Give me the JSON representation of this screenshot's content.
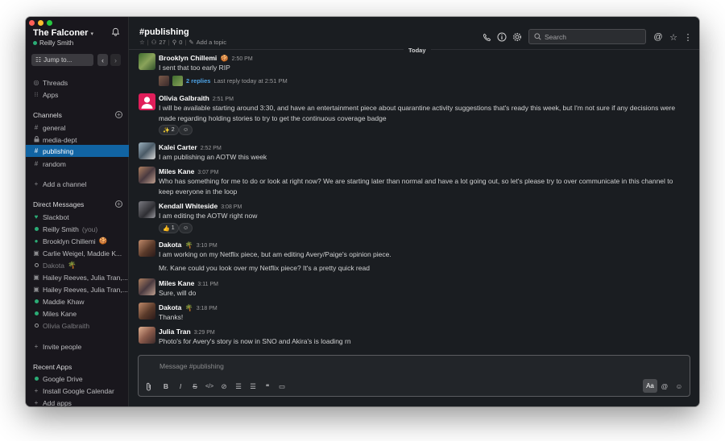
{
  "workspace": {
    "name": "The Falconer",
    "user": "Reilly Smith",
    "jump_label": "Jump to..."
  },
  "sidebar": {
    "threads": "Threads",
    "apps": "Apps",
    "channels_header": "Channels",
    "channels": [
      {
        "name": "general",
        "prefix": "#"
      },
      {
        "name": "media-dept",
        "prefix": "🔒"
      },
      {
        "name": "publishing",
        "prefix": "#",
        "active": true
      },
      {
        "name": "random",
        "prefix": "#"
      }
    ],
    "add_channel": "Add a channel",
    "dm_header": "Direct Messages",
    "dms": [
      {
        "label": "Slackbot",
        "icon": "heart"
      },
      {
        "label": "Reilly Smith",
        "suffix": "(you)",
        "icon": "online"
      },
      {
        "label": "Brooklyn Chillemi",
        "emoji": "🍪",
        "icon": "online-flag"
      },
      {
        "label": "Carlie Weigel, Maddie K...",
        "icon": "group"
      },
      {
        "label": "Dakota",
        "emoji": "🌴",
        "icon": "away"
      },
      {
        "label": "Hailey Reeves, Julia Tran,...",
        "icon": "group"
      },
      {
        "label": "Hailey Reeves, Julia Tran,...",
        "icon": "group"
      },
      {
        "label": "Maddie Khaw",
        "icon": "online"
      },
      {
        "label": "Miles Kane",
        "icon": "online"
      },
      {
        "label": "Olivia Galbraith",
        "icon": "away"
      }
    ],
    "invite": "Invite people",
    "apps_header": "Recent Apps",
    "recent_apps": [
      {
        "label": "Google Drive",
        "icon": "online"
      },
      {
        "label": "Install Google Calendar",
        "icon": "plus"
      },
      {
        "label": "Add apps",
        "icon": "plus"
      }
    ]
  },
  "channel": {
    "name": "#publishing",
    "members": "27",
    "pins": "0",
    "topic": "Add a topic",
    "search_placeholder": "Search",
    "divider": "Today"
  },
  "messages": [
    {
      "author": "Brooklyn Chillemi",
      "emoji": "🍪",
      "time": "2:50 PM",
      "text": "I sent that too early RIP",
      "avatar_color": "#4a7a3a",
      "thread": {
        "replies": "2 replies",
        "last": "Last reply today at 2:51 PM"
      }
    },
    {
      "author": "Olivia Galbraith",
      "time": "2:51 PM",
      "text": "I will be available starting around 3:30, and have an entertainment piece about quarantine activity suggestions that's ready this week, but I'm not sure if any decisions were made regarding holding stories to try to get the continuous coverage badge",
      "avatar_color": "#e01e5a",
      "reactions": [
        {
          "emoji": "✨",
          "count": "2"
        },
        {
          "emoji": "☺+",
          "count": ""
        }
      ]
    },
    {
      "author": "Kalei Carter",
      "time": "2:52 PM",
      "text": "I am publishing an AOTW this week",
      "avatar_color": "#6b7f8c"
    },
    {
      "author": "Miles Kane",
      "time": "3:07 PM",
      "text": "Who has something for me to do or look at right now? We are starting later than normal and have a lot going out, so let's please try to over communicate in this channel to keep everyone in the loop",
      "avatar_color": "#8a6a58"
    },
    {
      "author": "Kendall Whiteside",
      "time": "3:08 PM",
      "text": "I am editing the AOTW right now",
      "avatar_color": "#5a5a60",
      "reactions": [
        {
          "emoji": "👍",
          "count": "1"
        },
        {
          "emoji": "☺+",
          "count": ""
        }
      ]
    },
    {
      "author": "Dakota",
      "emoji": "🌴",
      "time": "3:10 PM",
      "text": "I am working on my Netflix piece, but am editing Avery/Paige's opinion piece.",
      "extra": "Mr. Kane could you look over my Netflix piece? It's a pretty quick read",
      "avatar_color": "#9a6a4a"
    },
    {
      "author": "Miles Kane",
      "time": "3:11 PM",
      "text": "Sure, will do",
      "avatar_color": "#8a6a58"
    },
    {
      "author": "Dakota",
      "emoji": "🌴",
      "time": "3:18 PM",
      "text": "Thanks!",
      "avatar_color": "#9a6a4a"
    },
    {
      "author": "Julia Tran",
      "time": "3:29 PM",
      "text": "Photo's for Avery's story is now in SNO and Akira's is loading rn",
      "avatar_color": "#b07a5a"
    }
  ],
  "composer": {
    "placeholder": "Message #publishing",
    "format_label": "Aa"
  }
}
